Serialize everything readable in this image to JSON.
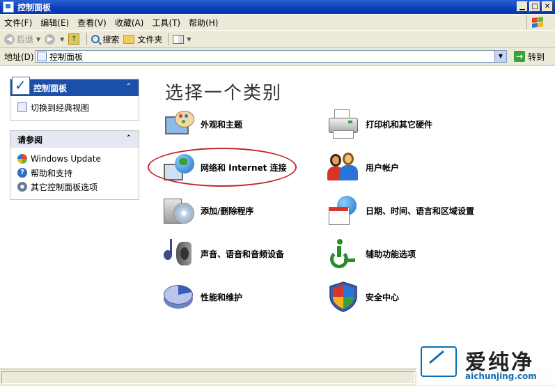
{
  "window": {
    "title": "控制面板"
  },
  "menu": [
    "文件(F)",
    "编辑(E)",
    "查看(V)",
    "收藏(A)",
    "工具(T)",
    "帮助(H)"
  ],
  "toolbar": {
    "back": "后退",
    "search": "搜索",
    "folders": "文件夹"
  },
  "address": {
    "label": "地址(D)",
    "value": "控制面板",
    "go": "转到"
  },
  "taskpane": {
    "cp_title": "控制面板",
    "switch_view": "切换到经典视图",
    "see_also_title": "请参阅",
    "see_also": [
      "Windows Update",
      "帮助和支持",
      "其它控制面板选项"
    ]
  },
  "main": {
    "heading": "选择一个类别",
    "categories": [
      "外观和主题",
      "打印机和其它硬件",
      "网络和 Internet 连接",
      "用户帐户",
      "添加/删除程序",
      "日期、时间、语言和区域设置",
      "声音、语音和音频设备",
      "辅助功能选项",
      "性能和维护",
      "安全中心"
    ]
  },
  "watermark": {
    "title": "爱纯净",
    "url": "aichunjing.com"
  },
  "colors": {
    "title_bar": "#0a3fb5",
    "chrome": "#ece9d8",
    "panel_blue": "#1c4fa8",
    "highlight_ellipse": "#c0272d"
  }
}
